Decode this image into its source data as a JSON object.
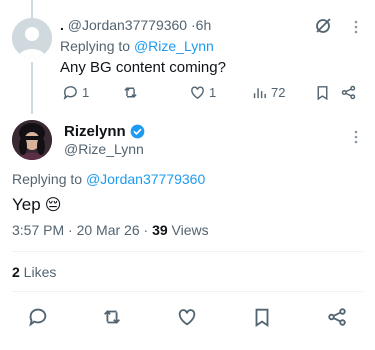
{
  "reply_tweet": {
    "display_name": ".",
    "handle": "@Jordan37779360",
    "time": "6h",
    "replying_prefix": "Replying to",
    "replying_to": "@Rize_Lynn",
    "text": "Any BG content coming?",
    "counts": {
      "replies": "1",
      "retweets": "",
      "likes": "1",
      "views": "72"
    }
  },
  "main_tweet": {
    "display_name": "Rizelynn",
    "handle": "@Rize_Lynn",
    "replying_prefix": "Replying to",
    "replying_to": "@Jordan37779360",
    "text": "Yep",
    "emoji": "😔",
    "timestamp": "3:57 PM · 20 Mar 26 · ",
    "views_count": "39",
    "views_label": " Views",
    "likes_count": "2",
    "likes_label": " Likes"
  },
  "colors": {
    "accent": "#1d9bf0",
    "muted": "#536471",
    "text": "#0f1419",
    "divider": "#eff3f4"
  }
}
